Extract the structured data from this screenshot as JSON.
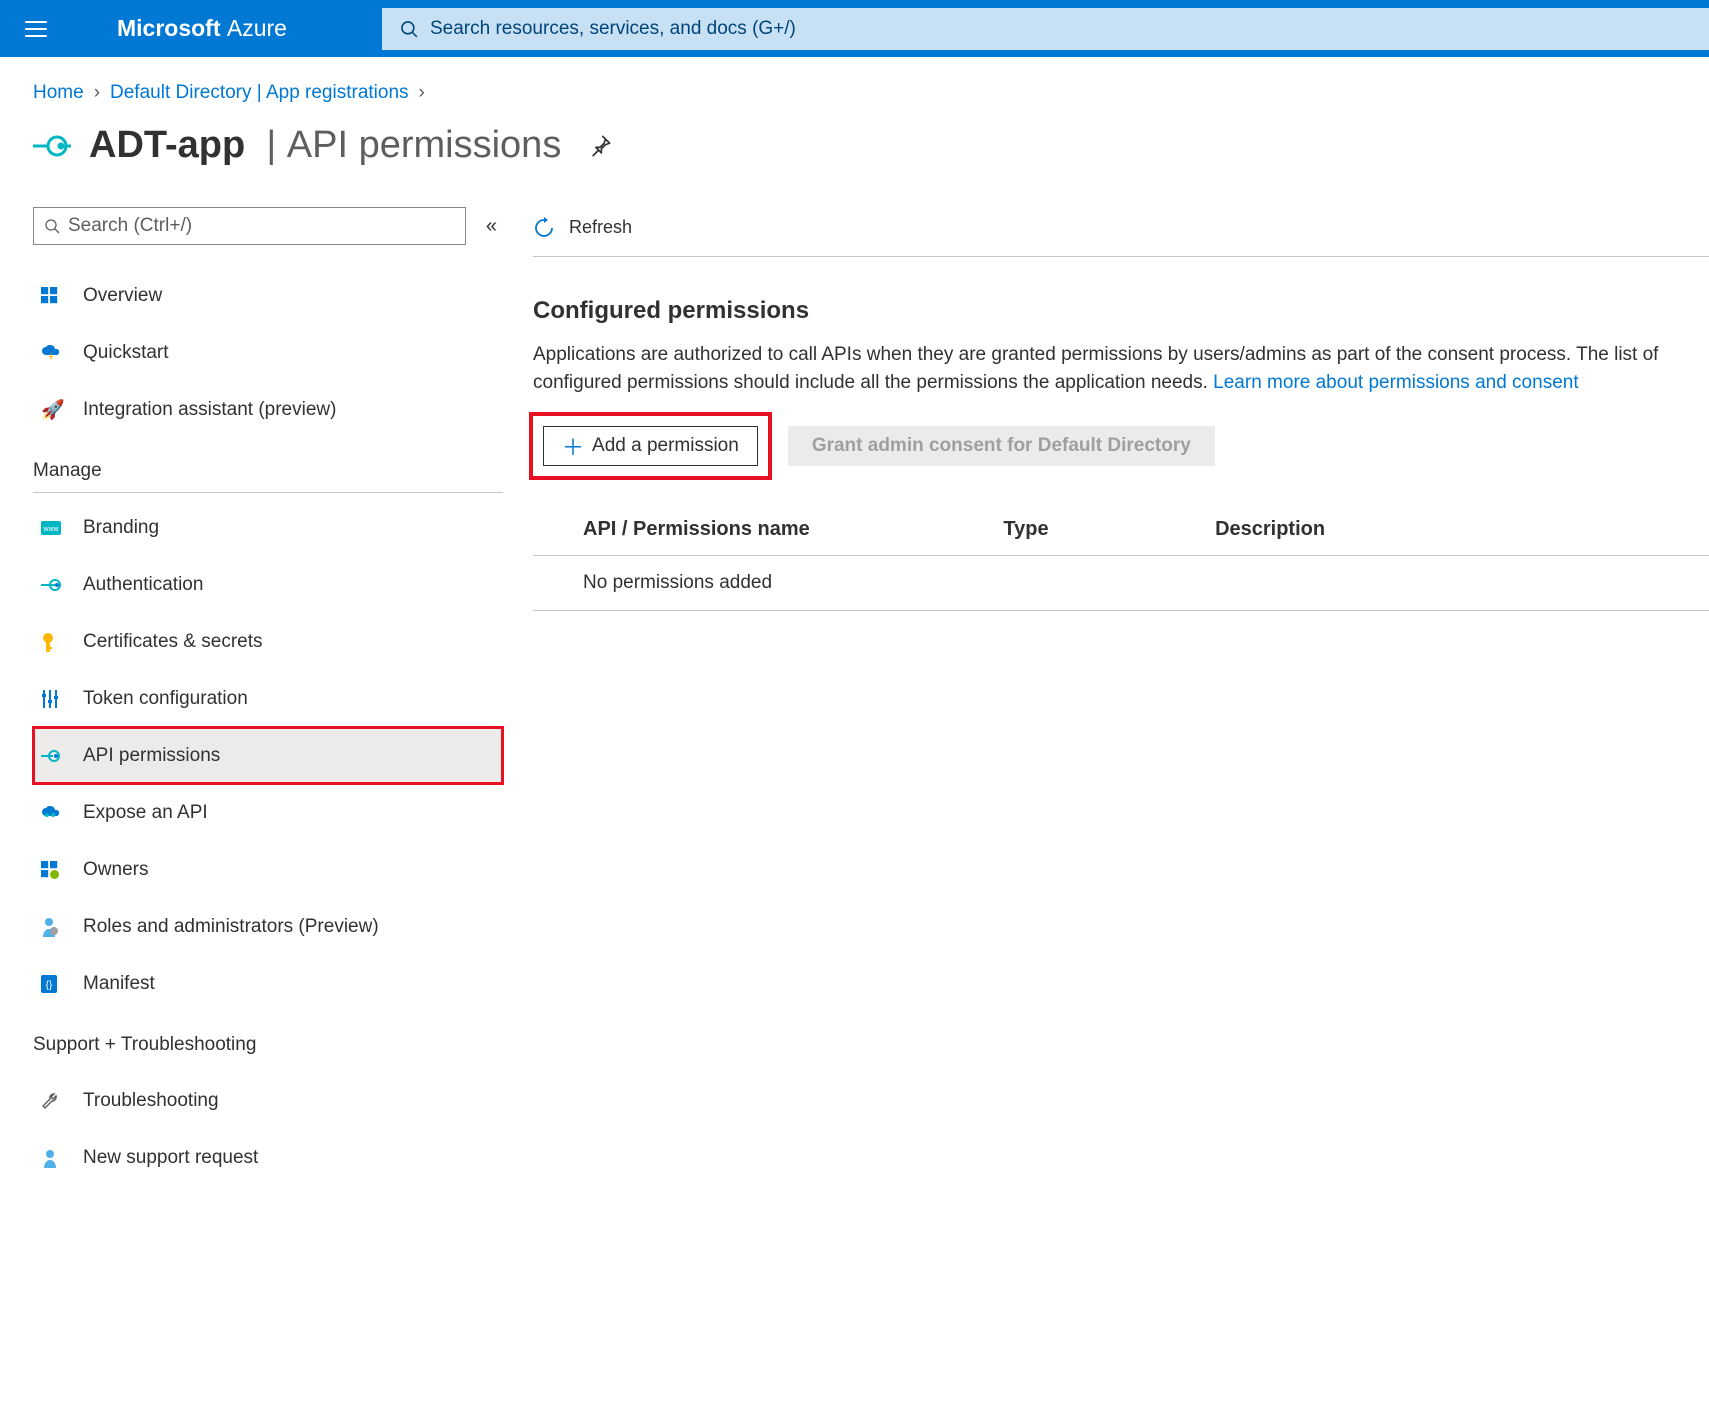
{
  "header": {
    "brand_bold": "Microsoft",
    "brand_light": "Azure",
    "search_placeholder": "Search resources, services, and docs (G+/)"
  },
  "breadcrumb": {
    "home": "Home",
    "dir": "Default Directory | App registrations"
  },
  "page": {
    "app_name": "ADT-app",
    "subtitle": "API permissions"
  },
  "sidebar": {
    "search_placeholder": "Search (Ctrl+/)",
    "top_items": [
      {
        "label": "Overview"
      },
      {
        "label": "Quickstart"
      },
      {
        "label": "Integration assistant (preview)"
      }
    ],
    "manage_label": "Manage",
    "manage_items": [
      {
        "label": "Branding"
      },
      {
        "label": "Authentication"
      },
      {
        "label": "Certificates & secrets"
      },
      {
        "label": "Token configuration"
      },
      {
        "label": "API permissions"
      },
      {
        "label": "Expose an API"
      },
      {
        "label": "Owners"
      },
      {
        "label": "Roles and administrators (Preview)"
      },
      {
        "label": "Manifest"
      }
    ],
    "support_label": "Support + Troubleshooting",
    "support_items": [
      {
        "label": "Troubleshooting"
      },
      {
        "label": "New support request"
      }
    ]
  },
  "main": {
    "refresh_label": "Refresh",
    "section_title": "Configured permissions",
    "section_desc": "Applications are authorized to call APIs when they are granted permissions by users/admins as part of the consent process. The list of configured permissions should include all the permissions the application needs.",
    "learn_more": "Learn more about permissions and consent",
    "add_permission_label": "Add a permission",
    "grant_consent_label": "Grant admin consent for Default Directory",
    "table": {
      "col_api": "API / Permissions name",
      "col_type": "Type",
      "col_desc": "Description",
      "empty_text": "No permissions added"
    }
  }
}
